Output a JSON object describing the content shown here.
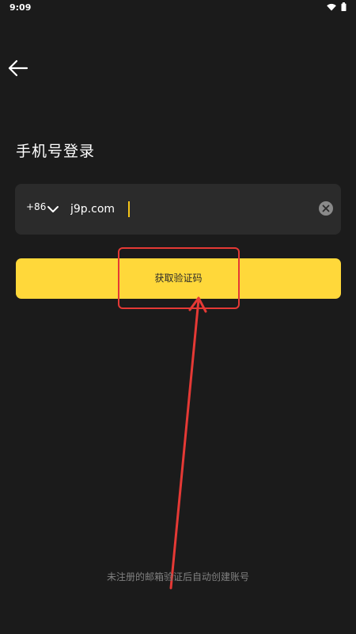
{
  "status_bar": {
    "time": "9:09",
    "icons": [
      "wifi-icon",
      "battery-icon"
    ]
  },
  "header": {
    "back_icon": "arrow-left-icon"
  },
  "main": {
    "title": "手机号登录",
    "phone_field": {
      "country_code": "+86",
      "value": "j9p.com",
      "clear_icon": "clear-icon"
    },
    "submit_button": "获取验证码",
    "footer_note": "未注册的邮箱验证后自动创建账号"
  },
  "colors": {
    "background": "#1b1b1b",
    "field_background": "#2b2b2b",
    "accent_yellow": "#ffd83a",
    "annotation_red": "#e53935",
    "muted_text": "#808080"
  }
}
